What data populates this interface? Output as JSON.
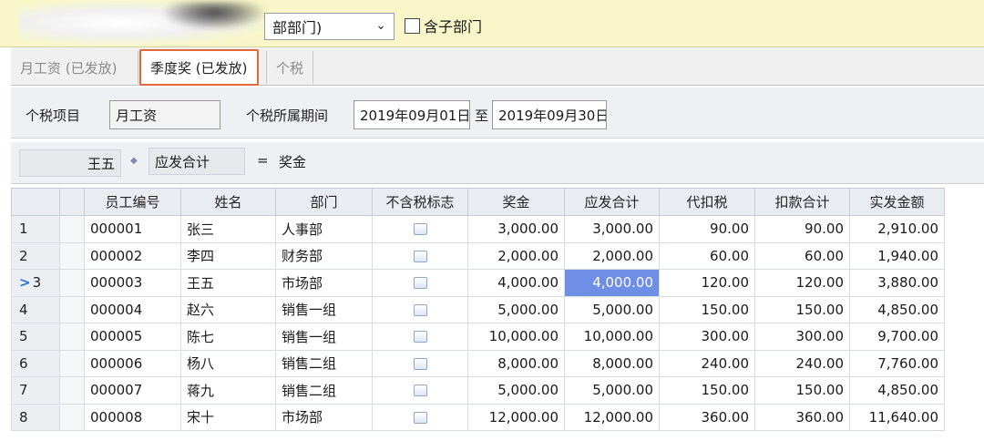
{
  "topbar": {
    "department_value": "部部门)",
    "include_sub_label": "含子部门"
  },
  "tabs": [
    {
      "label": "月工资 (已发放)"
    },
    {
      "label": "季度奖 (已发放)"
    },
    {
      "label": "个税"
    }
  ],
  "period": {
    "tax_item_label": "个税项目",
    "tax_item_value": "月工资",
    "period_label": "个税所属期间",
    "start_date": "2019年09月01日",
    "to_label": "至",
    "end_date": "2019年09月30日"
  },
  "formula": {
    "employee": "王五",
    "dot": "◆",
    "field": "应发合计",
    "equals": "=",
    "expression": "奖金"
  },
  "grid": {
    "columns": [
      "员工编号",
      "姓名",
      "部门",
      "不含税标志",
      "奖金",
      "应发合计",
      "代扣税",
      "扣款合计",
      "实发金额"
    ],
    "rows": [
      {
        "n": "1",
        "id": "000001",
        "name": "张三",
        "dept": "人事部",
        "bonus": "3,000.00",
        "gross": "3,000.00",
        "tax": "90.00",
        "deduct": "90.00",
        "net": "2,910.00"
      },
      {
        "n": "2",
        "id": "000002",
        "name": "李四",
        "dept": "财务部",
        "bonus": "2,000.00",
        "gross": "2,000.00",
        "tax": "60.00",
        "deduct": "60.00",
        "net": "1,940.00"
      },
      {
        "n": "3",
        "id": "000003",
        "name": "王五",
        "dept": "市场部",
        "bonus": "4,000.00",
        "gross": "4,000.00",
        "tax": "120.00",
        "deduct": "120.00",
        "net": "3,880.00"
      },
      {
        "n": "4",
        "id": "000004",
        "name": "赵六",
        "dept": "销售一组",
        "bonus": "5,000.00",
        "gross": "5,000.00",
        "tax": "150.00",
        "deduct": "150.00",
        "net": "4,850.00"
      },
      {
        "n": "5",
        "id": "000005",
        "name": "陈七",
        "dept": "销售一组",
        "bonus": "10,000.00",
        "gross": "10,000.00",
        "tax": "300.00",
        "deduct": "300.00",
        "net": "9,700.00"
      },
      {
        "n": "6",
        "id": "000006",
        "name": "杨八",
        "dept": "销售二组",
        "bonus": "8,000.00",
        "gross": "8,000.00",
        "tax": "240.00",
        "deduct": "240.00",
        "net": "7,760.00"
      },
      {
        "n": "7",
        "id": "000007",
        "name": "蒋九",
        "dept": "销售二组",
        "bonus": "5,000.00",
        "gross": "5,000.00",
        "tax": "150.00",
        "deduct": "150.00",
        "net": "4,850.00"
      },
      {
        "n": "8",
        "id": "000008",
        "name": "宋十",
        "dept": "市场部",
        "bonus": "12,000.00",
        "gross": "12,000.00",
        "tax": "360.00",
        "deduct": "360.00",
        "net": "11,640.00"
      }
    ],
    "current_row_marker": ">"
  },
  "colors": {
    "topbar_bg": "#f8f6c8",
    "active_tab_border": "#e06a3a",
    "selected_cell_bg": "#6f8ee6"
  },
  "icons": {
    "dropdown": "chevron-down-icon",
    "row_pointer": "current-row-pointer-icon",
    "tax_flag": "checkbox-icon"
  }
}
